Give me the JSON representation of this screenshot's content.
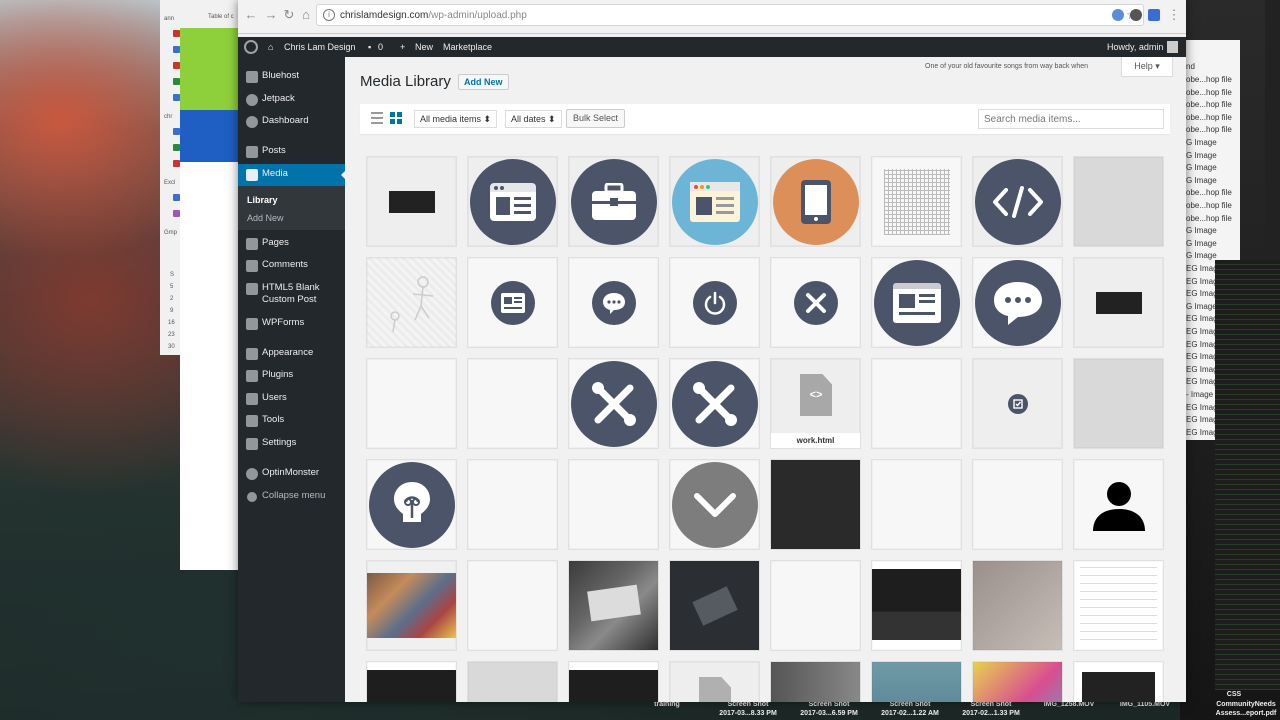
{
  "browser": {
    "url_host": "chrislamdesign.com",
    "url_path": "/wp-admin/upload.php"
  },
  "adminbar": {
    "site_name": "Chris Lam Design",
    "comments_count": "0",
    "new_label": "New",
    "marketplace_label": "Marketplace",
    "greeting": "Howdy, admin"
  },
  "sidebar": {
    "items": [
      {
        "label": "Bluehost"
      },
      {
        "label": "Jetpack"
      },
      {
        "label": "Dashboard"
      },
      {
        "label": "Posts"
      },
      {
        "label": "Media"
      },
      {
        "label": "Pages"
      },
      {
        "label": "Comments"
      },
      {
        "label": "HTML5 Blank\nCustom Post"
      },
      {
        "label": "WPForms"
      },
      {
        "label": "Appearance"
      },
      {
        "label": "Plugins"
      },
      {
        "label": "Users"
      },
      {
        "label": "Tools"
      },
      {
        "label": "Settings"
      },
      {
        "label": "OptinMonster"
      },
      {
        "label": "Collapse menu"
      }
    ],
    "submenu": {
      "library": "Library",
      "add_new": "Add New"
    }
  },
  "page": {
    "title": "Media Library",
    "add_new": "Add New",
    "song": "One of your old favourite songs from way back when",
    "help": "Help ▾"
  },
  "toolbar": {
    "filter_items": "All media items ⬍",
    "filter_dates": "All dates ⬍",
    "bulk_select": "Bulk Select",
    "search_placeholder": "Search media items..."
  },
  "media": {
    "file_label": "work.html"
  },
  "background": {
    "left_labels": [
      "Table of c",
      "ann",
      "chr",
      "Excl",
      "Gmp",
      "S",
      "2",
      "9",
      "16",
      "23",
      "30",
      "5",
      "2"
    ],
    "right_list": [
      "obe...hop file",
      "obe...hop file",
      "obe...hop file",
      "obe...hop file",
      "obe...hop file",
      "G Image",
      "G Image",
      "G Image",
      "G Image",
      "obe...hop file",
      "obe...hop file",
      "obe...hop file",
      "G Image",
      "G Image",
      "G Image",
      "EG Image",
      "EG Image",
      "EG Image",
      "G Image",
      "EG Image",
      "EG Image",
      "EG Image",
      "EG Image",
      "EG Image",
      "EG Image",
      "- Image",
      "EG Image",
      "EG Image",
      "EG Image"
    ],
    "right_header": "nd"
  },
  "dock": {
    "labels": [
      {
        "line1": "training",
        "line2": ""
      },
      {
        "line1": "Screen Shot",
        "line2": "2017-03...8.33 PM"
      },
      {
        "line1": "Screen Shot",
        "line2": "2017-03...6.59 PM"
      },
      {
        "line1": "Screen Shot",
        "line2": "2017-02...1.22 AM"
      },
      {
        "line1": "Screen Shot",
        "line2": "2017-02...1.33 PM"
      },
      {
        "line1": "IMG_1258.MOV",
        "line2": ""
      },
      {
        "line1": "IMG_1105.MOV",
        "line2": ""
      },
      {
        "line1": "CSS",
        "line2": ""
      },
      {
        "line1": "CommunityNeeds",
        "line2": "Assess...eport.pdf"
      }
    ]
  }
}
